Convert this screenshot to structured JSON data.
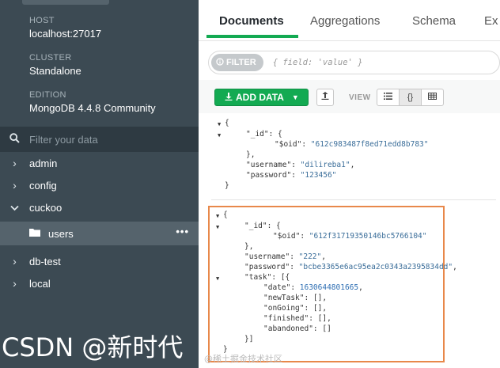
{
  "sidebar": {
    "host": {
      "label": "HOST",
      "value": "localhost:27017"
    },
    "cluster": {
      "label": "CLUSTER",
      "value": "Standalone"
    },
    "edition": {
      "label": "EDITION",
      "value": "MongoDB 4.4.8 Community"
    },
    "filter_placeholder": "Filter your data",
    "databases": [
      {
        "name": "admin"
      },
      {
        "name": "config"
      },
      {
        "name": "cuckoo",
        "collections": [
          {
            "name": "users"
          }
        ]
      },
      {
        "name": "db-test"
      },
      {
        "name": "local"
      }
    ]
  },
  "watermark": "CSDN @新时代",
  "corner_watermark": "@稀土掘金技术社区",
  "tabs": {
    "documents": "Documents",
    "aggregations": "Aggregations",
    "schema": "Schema",
    "explain": "Ex"
  },
  "query": {
    "filter_label": "FILTER",
    "filter_placeholder": "{ field: 'value' }"
  },
  "toolbar": {
    "add_data": "ADD DATA",
    "view_label": "VIEW"
  },
  "doc1": {
    "open": "{",
    "id_line": "\"_id\": {",
    "oid_key": "\"$oid\": ",
    "oid_val": "\"612c983487f8ed71edd8b783\"",
    "id_close": "},",
    "username_key": "\"username\": ",
    "username_val": "\"dilireba1\"",
    "password_key": "\"password\": ",
    "password_val": "\"123456\"",
    "close": "}"
  },
  "doc2": {
    "open": "{",
    "id_line": "\"_id\": {",
    "oid_key": "\"$oid\": ",
    "oid_val": "\"612f31719350146bc5766104\"",
    "id_close": "},",
    "username_key": "\"username\": ",
    "username_val": "\"222\"",
    "password_key": "\"password\": ",
    "password_val": "\"bcbe3365e6ac95ea2c0343a2395834dd\"",
    "task_line": "\"task\": [{",
    "date_key": "\"date\": ",
    "date_val": "1630644801665",
    "newtask": "\"newTask\": [],",
    "ongoing": "\"onGoing\": [],",
    "finished": "\"finished\": [],",
    "abandoned": "\"abandoned\": []",
    "task_close": "}]",
    "close": "}"
  }
}
